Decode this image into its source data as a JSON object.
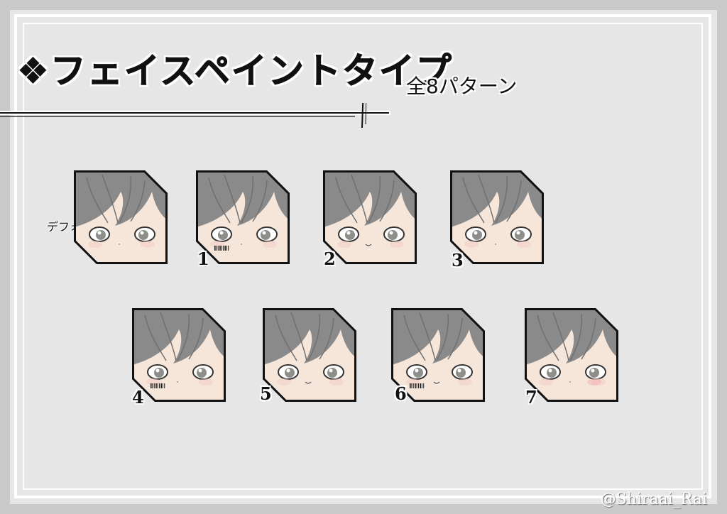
{
  "title": "❖フェイスペイントタイプ",
  "subtitle": "全8パターン",
  "default_label": "デフォ",
  "credit": "@Shiraai_Rai",
  "faces": [
    {
      "label": "",
      "mark": "none"
    },
    {
      "label": "1",
      "mark": "barcode-left"
    },
    {
      "label": "2",
      "mark": "nose-only"
    },
    {
      "label": "3",
      "mark": "none"
    },
    {
      "label": "4",
      "mark": "barcode-left"
    },
    {
      "label": "5",
      "mark": "nose-only"
    },
    {
      "label": "6",
      "mark": "barcode-left"
    },
    {
      "label": "7",
      "mark": "blush-right"
    }
  ],
  "colors": {
    "background": "#e6e6e6",
    "border": "#c9c9c9",
    "hair": "#8a8a8a",
    "skin": "#f6e6da"
  }
}
